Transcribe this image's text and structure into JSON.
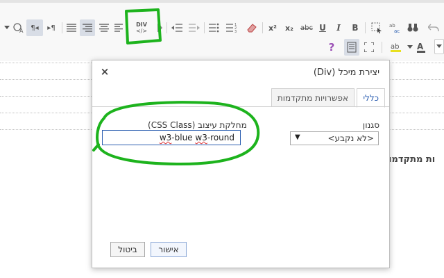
{
  "toolbar": {
    "row1": {
      "div_label": "DIV",
      "superscript": "x²",
      "subscript": "x₂",
      "strikethrough": "abc",
      "underline": "U",
      "italic": "I",
      "bold": "B",
      "pilcrow_rtl": "¶◂",
      "pilcrow_ltr": "▸¶"
    },
    "row2": {
      "help": "?"
    }
  },
  "editor": {
    "side_text": "ות מתקדמו"
  },
  "dialog": {
    "title": "יצירת מיכל (Div)",
    "close": "×",
    "tabs": [
      {
        "label": "כללי",
        "selected": true
      },
      {
        "label": "אפשרויות מתקדמות",
        "selected": false
      }
    ],
    "style_label": "סגנון",
    "style_value": "<לא נקבע>",
    "css_class_label": "מחלקת עיצוב (CSS Class)",
    "css_class_value_part1": "w3",
    "css_class_value_part2": "-blue ",
    "css_class_value_part3": "w3",
    "css_class_value_part4": "-round",
    "ok_button": "אישור",
    "cancel_button": "ביטול"
  },
  "colors": {
    "annotation": "#1db31d",
    "accent": "#2a5db0"
  }
}
